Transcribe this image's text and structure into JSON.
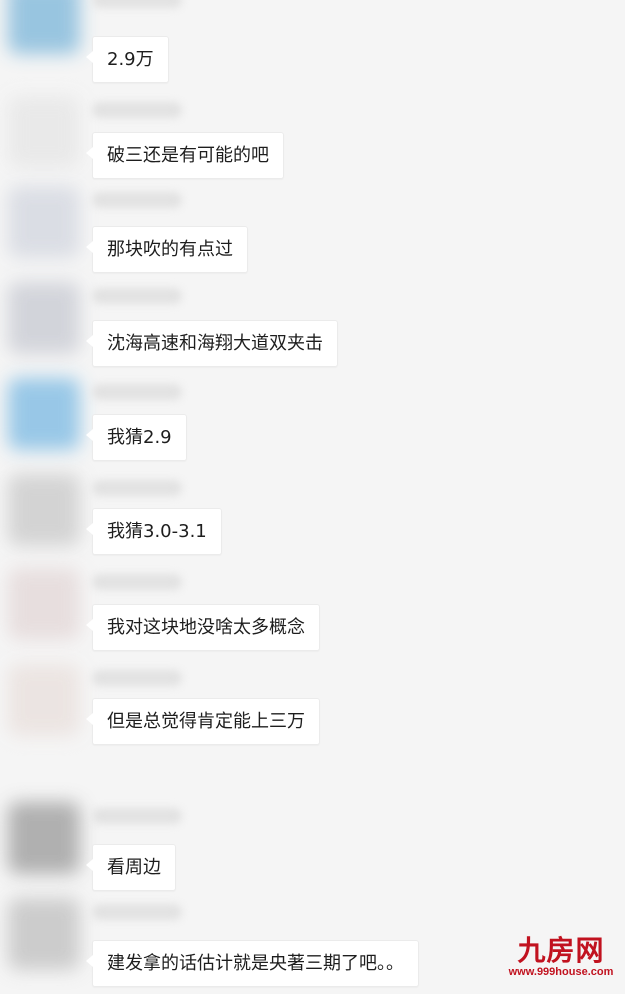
{
  "messages": [
    {
      "text": "2.9万",
      "avatar_color": "#8fc0de"
    },
    {
      "text": "破三还是有可能的吧",
      "avatar_color": "#e8e8e8"
    },
    {
      "text": "那块吹的有点过",
      "avatar_color": "#d8dbe3"
    },
    {
      "text": "沈海高速和海翔大道双夹击",
      "avatar_color": "#cfd1d8"
    },
    {
      "text": "我猜2.9",
      "avatar_color": "#8ec3e6"
    },
    {
      "text": "我猜3.0-3.1",
      "avatar_color": "#d0d0d0"
    },
    {
      "text": "我对这块地没啥太多概念",
      "avatar_color": "#e6dcdc"
    },
    {
      "text": "但是总觉得肯定能上三万",
      "avatar_color": "#ebe3e0"
    },
    {
      "text": "看周边",
      "avatar_color": "#a9a9a9"
    },
    {
      "text": "建发拿的话估计就是央著三期了吧。。",
      "avatar_color": "#c8c8c8"
    }
  ],
  "watermark": {
    "title": "九房网",
    "url": "www.999house.com",
    "color": "#c1121f"
  }
}
